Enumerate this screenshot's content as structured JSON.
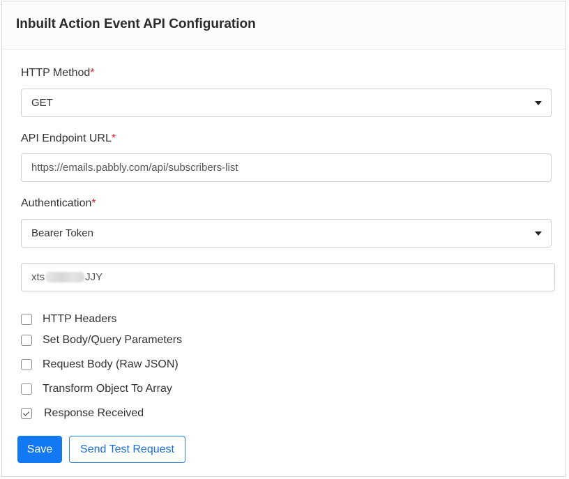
{
  "header": {
    "title": "Inbuilt Action Event API Configuration"
  },
  "http_method": {
    "label": "HTTP Method",
    "required_mark": "*",
    "selected": "GET"
  },
  "endpoint": {
    "label": "API Endpoint URL",
    "required_mark": "*",
    "value": "https://emails.pabbly.com/api/subscribers-list"
  },
  "authentication": {
    "label": "Authentication",
    "required_mark": "*",
    "selected": "Bearer Token"
  },
  "token": {
    "prefix": "xts",
    "suffix": "JJY"
  },
  "options": [
    {
      "label": "HTTP Headers",
      "checked": false
    },
    {
      "label": "Set Body/Query Parameters",
      "checked": false
    },
    {
      "label": "Request Body (Raw JSON)",
      "checked": false
    },
    {
      "label": "Transform Object To Array",
      "checked": false
    },
    {
      "label": "Response Received",
      "checked": true
    }
  ],
  "buttons": {
    "save": "Save",
    "send_test": "Send Test Request"
  }
}
